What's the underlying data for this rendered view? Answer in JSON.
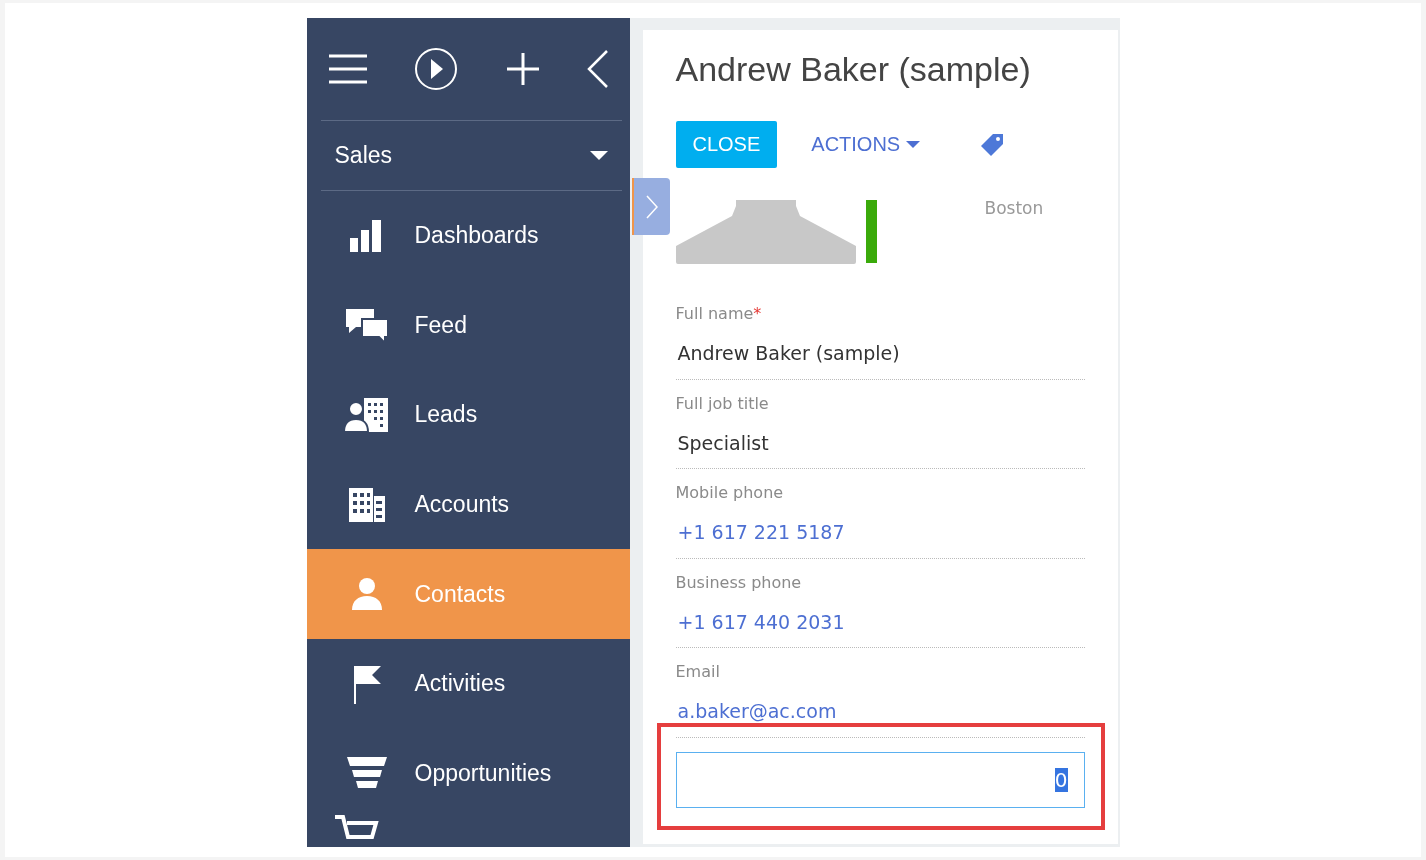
{
  "sidebar": {
    "section": {
      "label": "Sales"
    },
    "items": [
      {
        "kind": "dashboards",
        "label": "Dashboards",
        "selected": false
      },
      {
        "kind": "feed",
        "label": "Feed",
        "selected": false
      },
      {
        "kind": "leads",
        "label": "Leads",
        "selected": false
      },
      {
        "kind": "accounts",
        "label": "Accounts",
        "selected": false
      },
      {
        "kind": "contacts",
        "label": "Contacts",
        "selected": true
      },
      {
        "kind": "activities",
        "label": "Activities",
        "selected": false
      },
      {
        "kind": "opportunities",
        "label": "Opportunities",
        "selected": false
      }
    ]
  },
  "record": {
    "title": "Andrew Baker (sample)",
    "buttons": [
      {
        "kind": "primary",
        "label": "CLOSE"
      },
      {
        "kind": "menu",
        "label": "ACTIONS"
      }
    ],
    "city": "Boston",
    "fields": [
      {
        "label": "Full name",
        "required_mark": "*",
        "value": "Andrew Baker (sample)",
        "kind": "text"
      },
      {
        "label": "Full job title",
        "value": "Specialist",
        "kind": "text"
      },
      {
        "label": "Mobile phone",
        "value": "+1 617 221 5187",
        "kind": "link"
      },
      {
        "label": "Business phone",
        "value": "+1 617 440 2031",
        "kind": "link"
      },
      {
        "label": "Email",
        "value": "a.baker@ac.com",
        "kind": "link"
      }
    ],
    "input": {
      "value": "0",
      "text_selected": true
    }
  }
}
